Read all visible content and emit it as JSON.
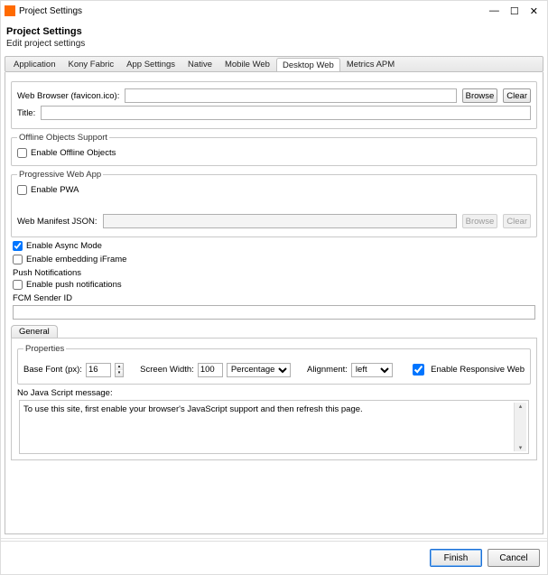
{
  "window": {
    "title": "Project Settings"
  },
  "header": {
    "title": "Project Settings",
    "subtitle": "Edit project settings"
  },
  "tabs": [
    {
      "label": "Application"
    },
    {
      "label": "Kony Fabric"
    },
    {
      "label": "App Settings"
    },
    {
      "label": "Native"
    },
    {
      "label": "Mobile Web"
    },
    {
      "label": "Desktop Web"
    },
    {
      "label": "Metrics APM"
    }
  ],
  "activeTabIndex": 5,
  "form": {
    "webBrowser": {
      "label": "Web Browser (favicon.ico):",
      "value": "",
      "browse": "Browse",
      "clear": "Clear"
    },
    "title": {
      "label": "Title:",
      "value": ""
    },
    "offline": {
      "legend": "Offline Objects Support",
      "checkbox": "Enable Offline Objects",
      "checked": false
    },
    "pwa": {
      "legend": "Progressive Web App",
      "checkbox": "Enable PWA",
      "checked": false,
      "manifest": {
        "label": "Web Manifest JSON:",
        "value": "",
        "browse": "Browse",
        "clear": "Clear"
      }
    },
    "async": {
      "label": "Enable Async Mode",
      "checked": true
    },
    "iframe": {
      "label": "Enable embedding iFrame",
      "checked": false
    },
    "push": {
      "label": "Push Notifications",
      "checkbox": "Enable push notifications",
      "checked": false
    },
    "fcm": {
      "label": "FCM Sender ID",
      "value": ""
    }
  },
  "general": {
    "tab": "General",
    "propsLegend": "Properties",
    "baseFont": {
      "label": "Base Font (px):",
      "value": "16"
    },
    "screenWidth": {
      "label": "Screen Width:",
      "value": "100",
      "unit": "Percentage"
    },
    "alignment": {
      "label": "Alignment:",
      "value": "left"
    },
    "responsive": {
      "label": "Enable Responsive Web",
      "checked": true
    },
    "noJs": {
      "label": "No Java Script message:",
      "value": "To use this site, first enable your browser's JavaScript support and then refresh this page."
    }
  },
  "footer": {
    "finish": "Finish",
    "cancel": "Cancel"
  }
}
